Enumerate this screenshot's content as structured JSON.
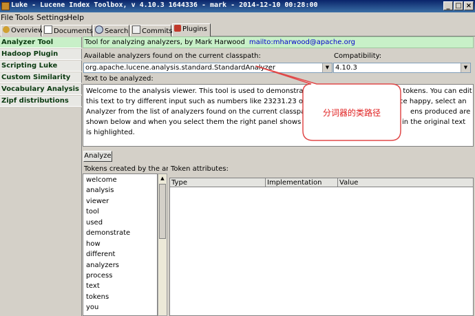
{
  "window": {
    "title": "Luke - Lucene Index Toolbox, v 4.10.3 1644336 - mark - 2014-12-10 00:28:00",
    "controls": [
      "_",
      "□",
      "×"
    ]
  },
  "menu": [
    "File",
    "Tools",
    "Settings",
    "Help"
  ],
  "tabs": [
    {
      "label": "Overview",
      "icon": "overview-icon"
    },
    {
      "label": "Documents",
      "icon": "documents-icon"
    },
    {
      "label": "Search",
      "icon": "search-icon"
    },
    {
      "label": "Commits",
      "icon": "commits-icon"
    },
    {
      "label": "Plugins",
      "icon": "plugins-icon"
    }
  ],
  "active_tab": "Plugins",
  "sidebar": [
    "Analyzer Tool",
    "Hadoop Plugin",
    "Scripting Luke",
    "Custom Similarity",
    "Vocabulary Analysis Tool",
    "Zipf distributions"
  ],
  "plugin": {
    "header": "Tool for analyzing analyzers, by Mark Harwood",
    "link": "mailto:mharwood@apache.org",
    "analyzers_label": "Available analyzers found on the current classpath:",
    "analyzer_value": "org.apache.lucene.analysis.standard.StandardAnalyzer",
    "compat_label": "Compatibility:",
    "compat_value": "4.10.3",
    "text_label": "Text to be analyzed:",
    "text_lines": [
      "Welcome to the analysis viewer. This tool is used to demonstrate how di",
      "into tokens. You can edit",
      "this text to try different input such as numbers like 23231.23 or characte",
      "ce happy, select an",
      "Analyzer from the list of analyzers found on the current classpath and th",
      "ens produced are",
      "shown below and when you select them the right panel shows their attri",
      "pan in the original text",
      "is highlighted."
    ],
    "analyze_button": "Analyze",
    "tokens_label": "Tokens created by the analy",
    "attrs_label": "Token attributes:",
    "tokens": [
      "welcome",
      "analysis",
      "viewer",
      "tool",
      "used",
      "demonstrate",
      "how",
      "different",
      "analyzers",
      "process",
      "text",
      "tokens",
      "you"
    ],
    "columns": [
      "Type",
      "Implementation",
      "Value"
    ]
  },
  "callout": {
    "text": "分词器的类路径",
    "color": "#e02020"
  }
}
